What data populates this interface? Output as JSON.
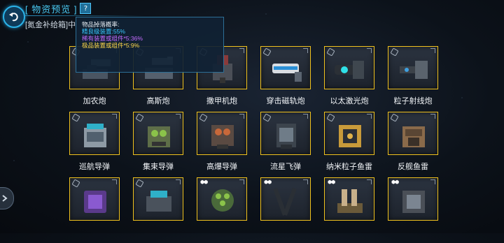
{
  "header": {
    "title": "[ 物资预览 ]",
    "help_label": "?",
    "box_label": "[氮金补给箱]中"
  },
  "tooltip": {
    "title": "物品掉落概率:",
    "lines": [
      {
        "text": "精良级装置:55%",
        "tier": "elite"
      },
      {
        "text": "稀有装置或组件*5:36%",
        "tier": "rare"
      },
      {
        "text": "极品装置或组件*5:9%",
        "tier": "epic"
      }
    ]
  },
  "colors": {
    "slot_border": "#f0c21e",
    "accent": "#49c9f2",
    "elite": "#39c7ff",
    "rare": "#c46bff",
    "epic": "#ffd84a"
  },
  "items": [
    {
      "name": "加农炮",
      "icon": "cannon-icon",
      "badge": "hex"
    },
    {
      "name": "高斯炮",
      "icon": "gauss-cannon-icon",
      "badge": "hex"
    },
    {
      "name": "撒甲机炮",
      "icon": "armor-piercing-gun-icon",
      "badge": "hex"
    },
    {
      "name": "穿击磁轨炮",
      "icon": "railgun-icon",
      "badge": "hex"
    },
    {
      "name": "以太激光炮",
      "icon": "ether-laser-icon",
      "badge": "hex"
    },
    {
      "name": "粒子射线炮",
      "icon": "particle-beam-icon",
      "badge": "hex"
    },
    {
      "name": "巡航导弹",
      "icon": "cruise-missile-icon",
      "badge": "hex"
    },
    {
      "name": "集束导弹",
      "icon": "cluster-missile-icon",
      "badge": "hex"
    },
    {
      "name": "高爆导弹",
      "icon": "high-explosive-missile-icon",
      "badge": "hex"
    },
    {
      "name": "流星飞弹",
      "icon": "meteor-missile-icon",
      "badge": "hex"
    },
    {
      "name": "纳米粒子鱼雷",
      "icon": "nano-torpedo-icon",
      "badge": "hex"
    },
    {
      "name": "反舰鱼雷",
      "icon": "anti-ship-torpedo-icon",
      "badge": "hex"
    },
    {
      "name": "",
      "icon": "purple-launcher-icon",
      "badge": "hex"
    },
    {
      "name": "",
      "icon": "turret-module-icon",
      "badge": "hex"
    },
    {
      "name": "",
      "icon": "green-pod-icon",
      "badge": "dots"
    },
    {
      "name": "",
      "icon": "blade-component-icon",
      "badge": "dots"
    },
    {
      "name": "",
      "icon": "missile-rack-icon",
      "badge": "dots"
    },
    {
      "name": "",
      "icon": "armored-box-icon",
      "badge": "dots"
    }
  ]
}
